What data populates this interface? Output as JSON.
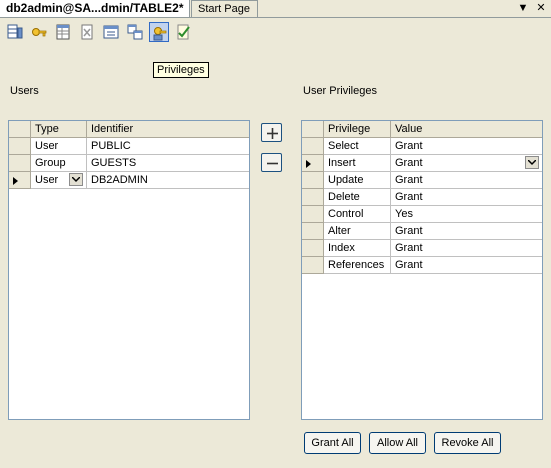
{
  "tabs": {
    "active": "db2admin@SA...dmin/TABLE2*",
    "start": "Start Page"
  },
  "window": {
    "dropdown_glyph": "▼",
    "close_glyph": "✕"
  },
  "toolbar": {
    "buttons": [
      "columns-icon",
      "key-icon",
      "table-properties-icon",
      "delete-icon",
      "index-icon",
      "relations-icon",
      "privileges-icon",
      "check-icon"
    ],
    "pressed": "privileges-icon"
  },
  "tooltip": "Privileges",
  "users": {
    "label": "Users",
    "columns": [
      "Type",
      "Identifier"
    ],
    "rows": [
      {
        "type": "User",
        "identifier": "PUBLIC"
      },
      {
        "type": "Group",
        "identifier": "GUESTS"
      },
      {
        "type": "User",
        "identifier": "DB2ADMIN"
      }
    ],
    "selected_row": 2
  },
  "privileges": {
    "label": "User Privileges",
    "columns": [
      "Privilege",
      "Value"
    ],
    "rows": [
      {
        "privilege": "Select",
        "value": "Grant"
      },
      {
        "privilege": "Insert",
        "value": "Grant"
      },
      {
        "privilege": "Update",
        "value": "Grant"
      },
      {
        "privilege": "Delete",
        "value": "Grant"
      },
      {
        "privilege": "Control",
        "value": "Yes"
      },
      {
        "privilege": "Alter",
        "value": "Grant"
      },
      {
        "privilege": "Index",
        "value": "Grant"
      },
      {
        "privilege": "References",
        "value": "Grant"
      }
    ],
    "selected_row": 1
  },
  "buttons": {
    "grant_all": "Grant All",
    "allow_all": "Allow All",
    "revoke_all": "Revoke All"
  },
  "colors": {
    "background": "#ece9d8",
    "grid_border": "#7f9db9",
    "tooltip": "#ffffe1",
    "button_border": "#003c74"
  }
}
